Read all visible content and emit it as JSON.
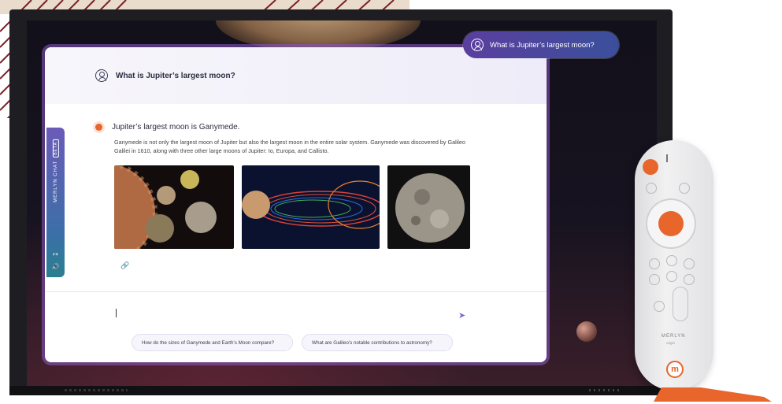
{
  "query_pill": {
    "text": "What is Jupiter’s largest moon?",
    "icon": "user-icon"
  },
  "chat": {
    "question": "What is Jupiter’s largest moon?",
    "answer_title": "Jupiter’s largest moon is Ganymede.",
    "answer_body": "Ganymede is not only the largest moon of Jupiter but also the largest moon in the entire solar system. Ganymede was discovered by Galileo Galilei in 1610, along with three other large moons of Jupiter: Io, Europa, and Callisto.",
    "images": [
      "jupiter-and-moons-image",
      "jupiter-orbits-image",
      "ganymede-image"
    ],
    "link_icon": "link-icon",
    "input_value": "",
    "send_icon": "send-icon",
    "suggestions": [
      "How do the sizes of Ganymede and Earth's Moon compare?",
      "What are Galileo's notable contributions to astronomy?"
    ]
  },
  "side_tab": {
    "label": "MERLYN CHAT",
    "badge": "BETA",
    "icons": [
      "exit-icon",
      "speaker-icon"
    ]
  },
  "remote": {
    "brand": "MERLYN",
    "sub": "origin",
    "logo": "m"
  },
  "colors": {
    "accent_orange": "#e8652c",
    "accent_purple": "#5b3f9e",
    "text_dark": "#2b2e42"
  }
}
